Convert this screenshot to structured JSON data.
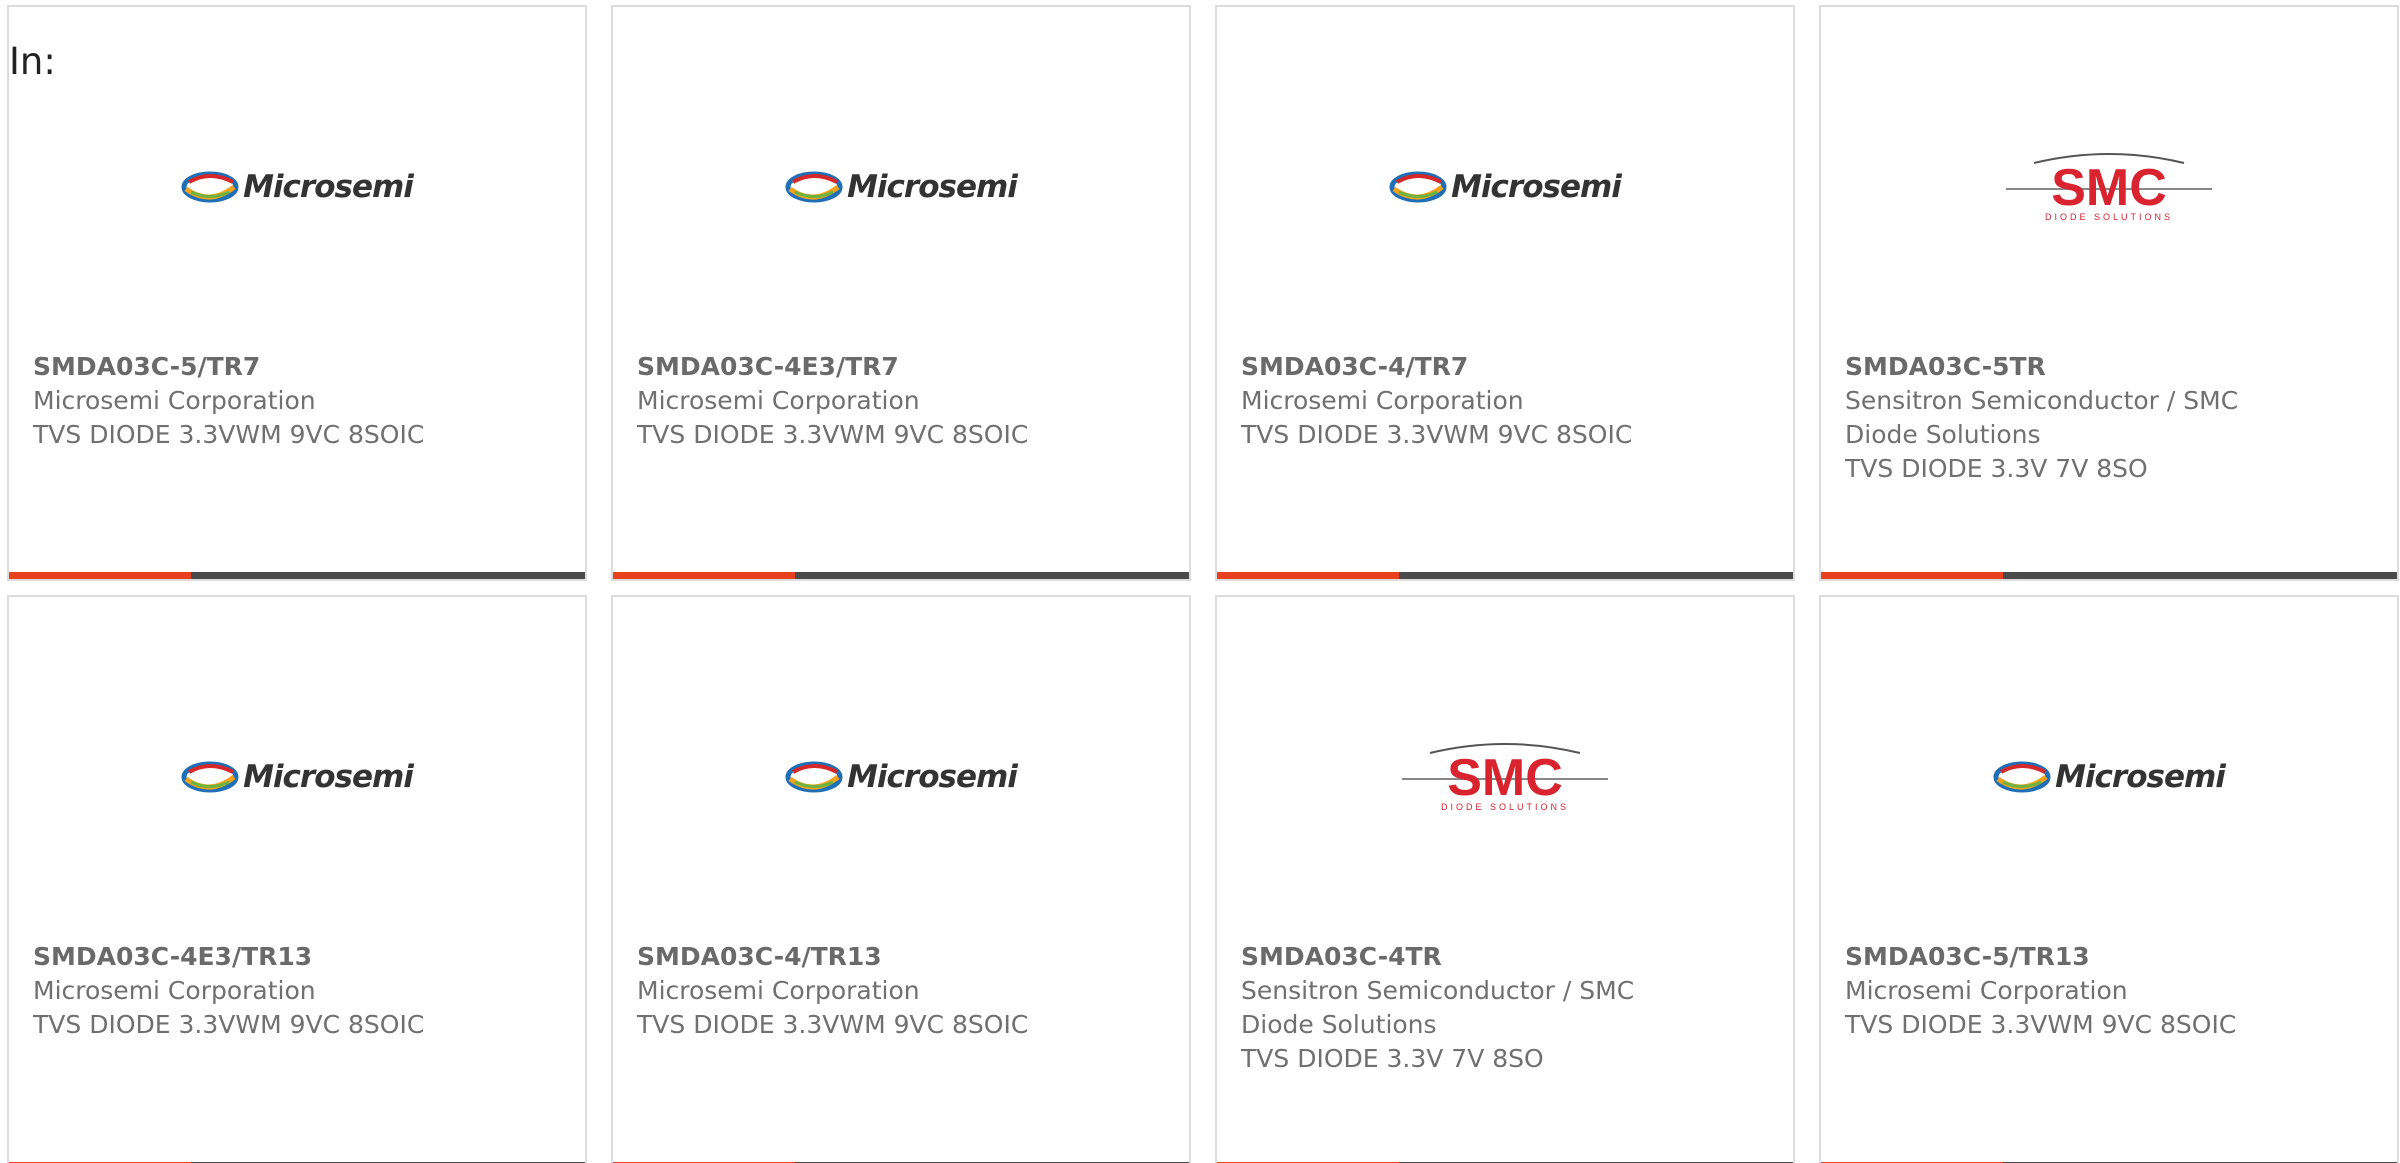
{
  "in_label": "In:",
  "accent_color": "#e8401c",
  "bar_color": "#4a4a4a",
  "cards": [
    {
      "part": "SMDA03C-5/TR7",
      "manufacturer": "Microsemi Corporation",
      "manufacturer_line2": "",
      "description": "TVS DIODE 3.3VWM 9VC 8SOIC",
      "logo": "microsemi-logo",
      "logo_text": "Microsemi"
    },
    {
      "part": "SMDA03C-4E3/TR7",
      "manufacturer": "Microsemi Corporation",
      "manufacturer_line2": "",
      "description": "TVS DIODE 3.3VWM 9VC 8SOIC",
      "logo": "microsemi-logo",
      "logo_text": "Microsemi"
    },
    {
      "part": "SMDA03C-4/TR7",
      "manufacturer": "Microsemi Corporation",
      "manufacturer_line2": "",
      "description": "TVS DIODE 3.3VWM 9VC 8SOIC",
      "logo": "microsemi-logo",
      "logo_text": "Microsemi"
    },
    {
      "part": "SMDA03C-5TR",
      "manufacturer": "Sensitron Semiconductor / SMC",
      "manufacturer_line2": "Diode Solutions",
      "description": "TVS DIODE 3.3V 7V 8SO",
      "logo": "smc-logo",
      "logo_text": "SMC",
      "logo_subtext": "DIODE SOLUTIONS"
    },
    {
      "part": "SMDA03C-4E3/TR13",
      "manufacturer": "Microsemi Corporation",
      "manufacturer_line2": "",
      "description": "TVS DIODE 3.3VWM 9VC 8SOIC",
      "logo": "microsemi-logo",
      "logo_text": "Microsemi"
    },
    {
      "part": "SMDA03C-4/TR13",
      "manufacturer": "Microsemi Corporation",
      "manufacturer_line2": "",
      "description": "TVS DIODE 3.3VWM 9VC 8SOIC",
      "logo": "microsemi-logo",
      "logo_text": "Microsemi"
    },
    {
      "part": "SMDA03C-4TR",
      "manufacturer": "Sensitron Semiconductor / SMC",
      "manufacturer_line2": "Diode Solutions",
      "description": "TVS DIODE 3.3V 7V 8SO",
      "logo": "smc-logo",
      "logo_text": "SMC",
      "logo_subtext": "DIODE SOLUTIONS"
    },
    {
      "part": "SMDA03C-5/TR13",
      "manufacturer": "Microsemi Corporation",
      "manufacturer_line2": "",
      "description": "TVS DIODE 3.3VWM 9VC 8SOIC",
      "logo": "microsemi-logo",
      "logo_text": "Microsemi"
    }
  ]
}
